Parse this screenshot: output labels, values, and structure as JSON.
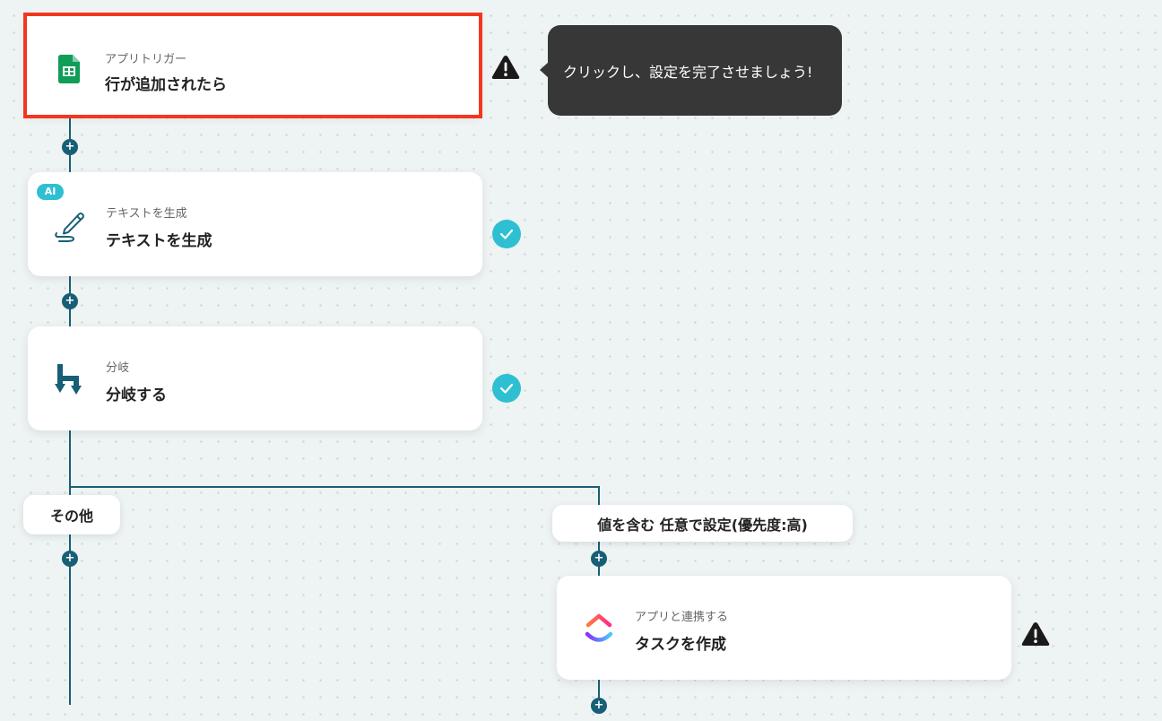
{
  "steps": {
    "trigger": {
      "sub": "アプリトリガー",
      "title": "行が追加されたら",
      "icon": "google-sheets-icon",
      "status": "warning"
    },
    "ai_text": {
      "badge": "AI",
      "sub": "テキストを生成",
      "title": "テキストを生成",
      "icon": "pen-icon",
      "status": "complete"
    },
    "branch": {
      "sub": "分岐",
      "title": "分岐する",
      "icon": "branch-icon",
      "status": "complete"
    },
    "clickup_task": {
      "sub": "アプリと連携する",
      "title": "タスクを作成",
      "icon": "clickup-icon",
      "status": "warning"
    }
  },
  "tooltip": {
    "text": "クリックし、設定を完了させましょう!"
  },
  "branches": {
    "other_label": "その他",
    "condition_label": "値を含む 任意で設定(優先度:高)"
  },
  "colors": {
    "connector": "#175f76",
    "selected_outline": "#f2371f",
    "check": "#2ec0d2",
    "tooltip_bg": "#373737",
    "sheets_green": "#0f9d58"
  }
}
